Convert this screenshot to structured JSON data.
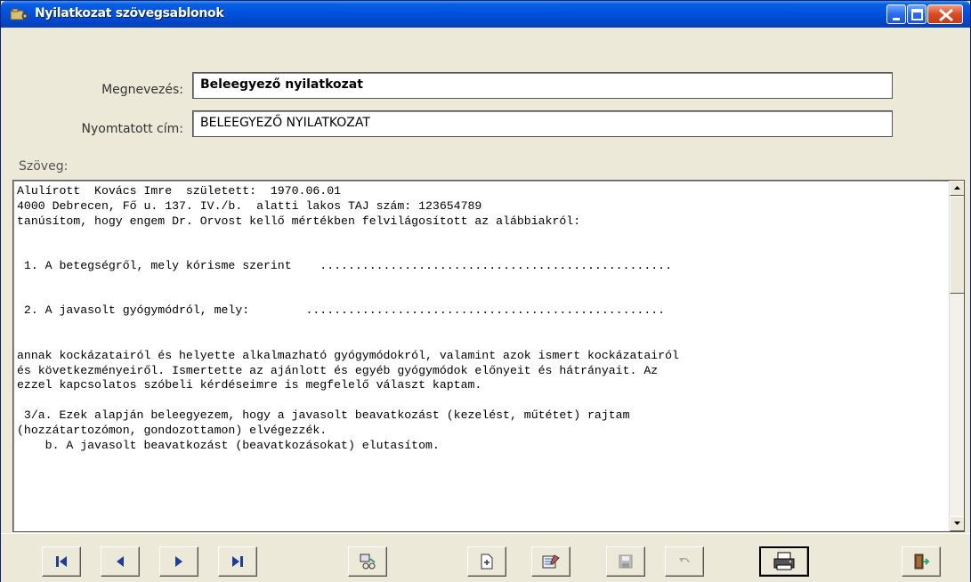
{
  "window": {
    "title": "Nyilatkozat szövegsablonok",
    "icons": {
      "app": "folder-app-icon",
      "minimize": "minimize-icon",
      "maximize": "maximize-icon",
      "close": "close-icon"
    }
  },
  "form": {
    "megnevezes_label": "Megnevezés:",
    "megnevezes_value": "Beleegyező nyilatkozat",
    "nyomtatott_cim_label": "Nyomtatott cím:",
    "nyomtatott_cim_value": "BELEEGYEZŐ NYILATKOZAT",
    "szoveg_label": "Szöveg:"
  },
  "memo": {
    "text": "Alulírott  Kovács Imre  született:  1970.06.01\n4000 Debrecen, Fő u. 137. IV./b.  alatti lakos TAJ szám: 123654789\ntanúsítom, hogy engem Dr. Orvost kellő mértékben felvilágosított az alábbiakról:\n\n\n 1. A betegségről, mely kórisme szerint    ..................................................\n\n\n 2. A javasolt gyógymódról, mely:        ...................................................\n\n\nannak kockázatairól és helyette alkalmazható gyógymódokról, valamint azok ismert kockázatairól\nés következményeiről. Ismertette az ajánlott és egyéb gyógymódok előnyeit és hátrányait. Az\nezzel kapcsolatos szóbeli kérdéseimre is megfelelő választ kaptam.\n\n 3/a. Ezek alapján beleegyezem, hogy a javasolt beavatkozást (kezelést, műtétet) rajtam\n(hozzátartozómon, gondozottamon) elvégezzék.\n    b. A javasolt beavatkozást (beavatkozásokat) elutasítom."
  },
  "toolbar": {
    "buttons": [
      {
        "name": "first-record-button",
        "icon": "first-icon"
      },
      {
        "name": "prev-record-button",
        "icon": "prev-icon"
      },
      {
        "name": "next-record-button",
        "icon": "next-icon"
      },
      {
        "name": "last-record-button",
        "icon": "last-icon"
      },
      {
        "name": "field-tool-button",
        "icon": "field-tool-icon"
      },
      {
        "name": "new-record-button",
        "icon": "new-document-icon"
      },
      {
        "name": "edit-record-button",
        "icon": "edit-icon"
      },
      {
        "name": "save-button",
        "icon": "save-icon",
        "enabled": false
      },
      {
        "name": "undo-button",
        "icon": "undo-icon",
        "enabled": false
      },
      {
        "name": "print-button",
        "icon": "printer-icon"
      },
      {
        "name": "exit-button",
        "icon": "exit-door-icon"
      }
    ]
  },
  "colors": {
    "title_bar": "#0054e3",
    "window_bg": "#ece9d8",
    "nav_arrow": "#1f3d9a"
  }
}
